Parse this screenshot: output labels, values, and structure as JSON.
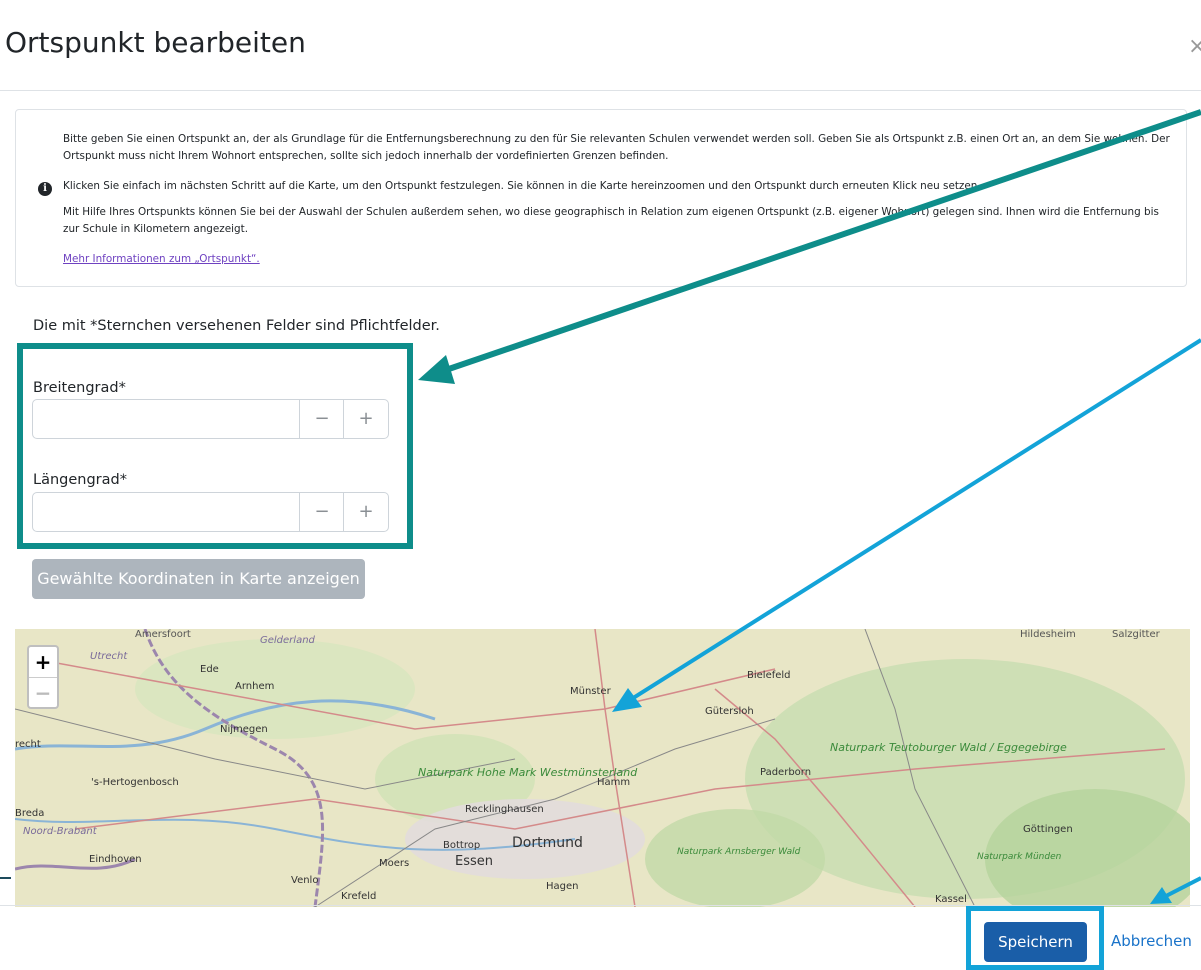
{
  "dialog": {
    "title": "Ortspunkt bearbeiten",
    "close": "×"
  },
  "info": {
    "icon": "info-icon",
    "paragraphs": [
      "Bitte geben Sie einen Ortspunkt an, der als Grundlage für die Entfernungsberechnung zu den für Sie relevanten Schulen verwendet werden soll. Geben Sie als Ortspunkt z.B. einen Ort an, an dem Sie wohnen. Der Ortspunkt muss nicht Ihrem Wohnort entsprechen, sollte sich jedoch innerhalb der vordefinierten Grenzen befinden.",
      "Klicken Sie einfach im nächsten Schritt auf die Karte, um den Ortspunkt festzulegen. Sie können in die Karte hereinzoomen und den Ortspunkt durch erneuten Klick neu setzen.",
      "Mit Hilfe Ihres Ortspunkts können Sie bei der Auswahl der Schulen außerdem sehen, wo diese geographisch in Relation zum eigenen Ortspunkt (z.B. eigener Wohnort) gelegen sind. Ihnen wird die Entfernung bis zur Schule in Kilometern angezeigt."
    ],
    "link": "Mehr Informationen zum „Ortspunkt“."
  },
  "form": {
    "required_note": "Die mit *Sternchen versehenen Felder sind Pflichtfelder.",
    "latitude_label": "Breitengrad*",
    "latitude_value": "",
    "longitude_label": "Längengrad*",
    "longitude_value": "",
    "minus": "−",
    "plus": "+",
    "show_button": "Gewählte Koordinaten in Karte anzeigen"
  },
  "map": {
    "zoom_in": "+",
    "zoom_out": "−",
    "places": [
      "Amersfoort",
      "Gelderland",
      "Utrecht",
      "Ede",
      "Arnhem",
      "Nijmegen",
      "recht",
      "'s-Hertogenbosch",
      "Breda",
      "Noord-Brabant",
      "Eindhoven",
      "Venlo",
      "Krefeld",
      "Moers",
      "Bottrop",
      "Essen",
      "Dortmund",
      "Recklinghausen",
      "Hamm",
      "Hagen",
      "Münster",
      "Bielefeld",
      "Gütersloh",
      "Paderborn",
      "Naturpark Hohe Mark Westmünsterland",
      "Naturpark Teutoburger Wald / Eggegebirge",
      "Naturpark Arnsberger Wald",
      "Hildesheim",
      "Salzgitter",
      "Göttingen",
      "Naturpark Münden",
      "Kassel"
    ]
  },
  "footer": {
    "save": "Speichern",
    "cancel": "Abbrechen"
  },
  "colors": {
    "teal_highlight": "#0e8d8a",
    "blue_highlight": "#13a3d8",
    "primary": "#1a5ea8",
    "secondary": "#adb5bd"
  }
}
